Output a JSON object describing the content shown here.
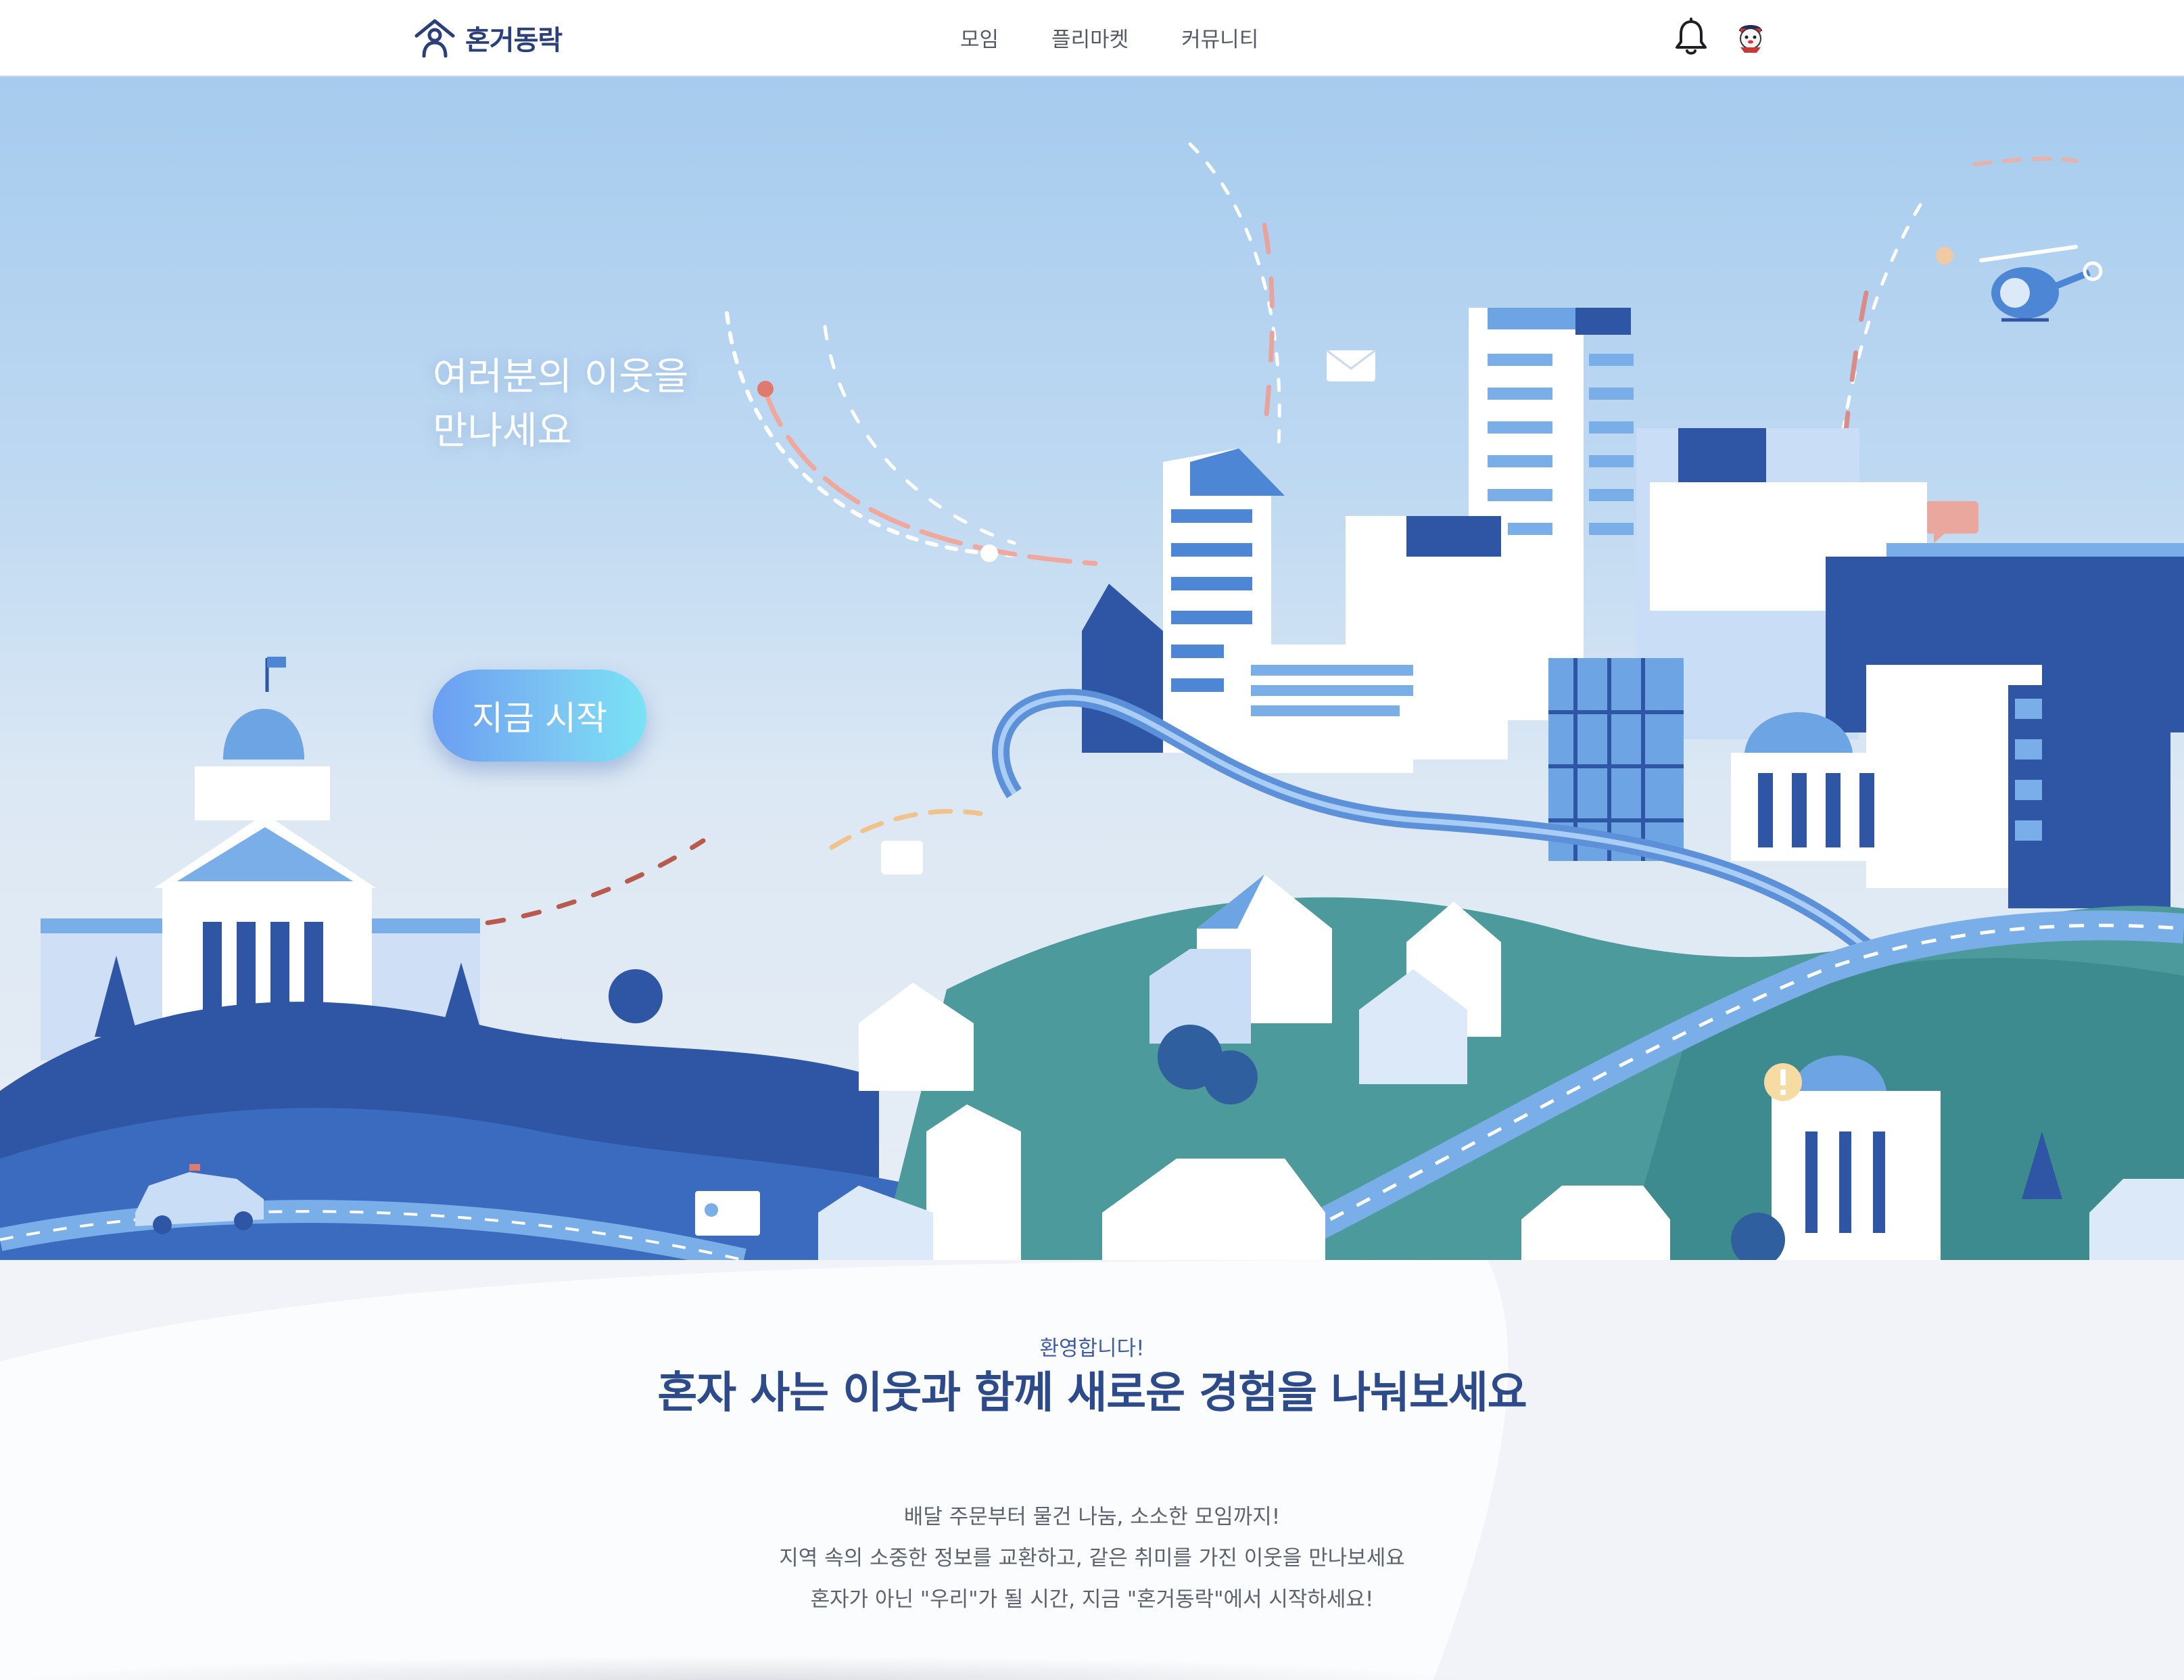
{
  "header": {
    "logo_text": "혼거동락",
    "logo_icon": "house-person-icon",
    "nav": [
      {
        "label": "모임"
      },
      {
        "label": "플리마켓"
      },
      {
        "label": "커뮤니티"
      }
    ],
    "notification_icon": "bell-icon",
    "avatar_icon": "user-avatar-icon"
  },
  "hero": {
    "title_line1": "여러분의 이웃을",
    "title_line2": "만나세요",
    "start_button": "지금 시작"
  },
  "intro": {
    "welcome": "환영합니다!",
    "headline": "혼자 사는 이웃과 함께 새로운 경험을 나눠보세요",
    "description": [
      "배달 주문부터 물건 나눔, 소소한 모임까지!",
      "지역 속의 소중한 정보를 교환하고, 같은 취미를 가진 이웃을 만나보세요",
      "혼자가 아닌 \"우리\"가 될 시간, 지금 \"혼거동락\"에서 시작하세요!"
    ]
  },
  "colors": {
    "brand_navy": "#2b3f7a",
    "headline_blue": "#2d4a8a",
    "button_start": "#6b9ef2",
    "button_end": "#79e3f4"
  }
}
